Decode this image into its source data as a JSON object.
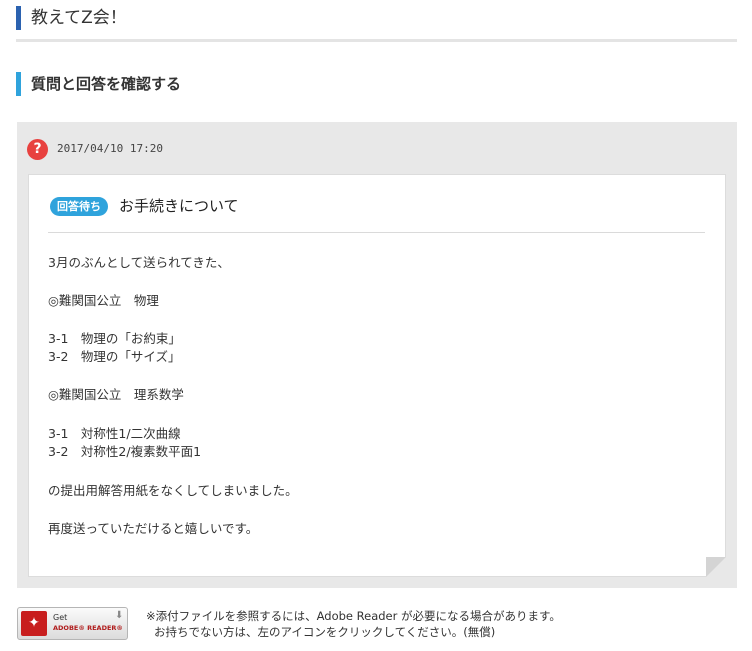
{
  "page_header": {
    "title": "教えてZ会！"
  },
  "section": {
    "title": "質問と回答を確認する"
  },
  "question": {
    "icon": "question-icon",
    "timestamp": "2017/04/10 17:20",
    "status_badge": "回答待ち",
    "title": "お手続きについて",
    "body_lines": [
      "3月のぶんとして送られてきた、",
      "◎難関国公立　物理",
      "3-1　物理の「お約束」",
      "3-2　物理の「サイズ」",
      "◎難関国公立　理系数学",
      "3-1　対称性1/二次曲線",
      "3-2　対称性2/複素数平面1",
      "の提出用解答用紙をなくしてしまいました。",
      "再度送っていただけると嬉しいです。"
    ]
  },
  "acrobat": {
    "get": "Get",
    "reader": "ADOBE® READER®",
    "icon": "adobe-acrobat-icon"
  },
  "notice": {
    "line1": "※添付ファイルを参照するには、Adobe Reader が必要になる場合があります。",
    "line2": "お持ちでない方は、左のアイコンをクリックしてください。(無償)"
  },
  "colors": {
    "header_bar": "#2b62b0",
    "section_bar": "#2fa3dc",
    "badge": "#2fa3dc",
    "question_icon": "#e8413f"
  }
}
